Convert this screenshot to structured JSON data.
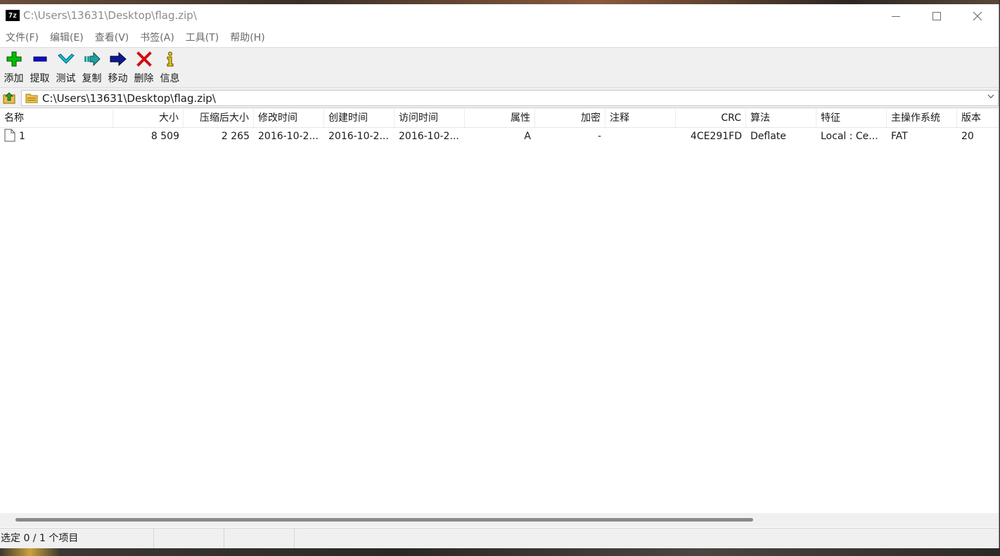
{
  "window": {
    "title": "C:\\Users\\13631\\Desktop\\flag.zip\\",
    "app_icon_text": "7z"
  },
  "menu": [
    {
      "label": "文件(F)"
    },
    {
      "label": "编辑(E)"
    },
    {
      "label": "查看(V)"
    },
    {
      "label": "书签(A)"
    },
    {
      "label": "工具(T)"
    },
    {
      "label": "帮助(H)"
    }
  ],
  "toolbar": [
    {
      "label": "添加",
      "icon": "plus-icon",
      "color": "#00c000"
    },
    {
      "label": "提取",
      "icon": "minus-icon",
      "color": "#1010c0"
    },
    {
      "label": "测试",
      "icon": "check-icon",
      "color": "#00b8c8"
    },
    {
      "label": "复制",
      "icon": "copy-arrow-icon",
      "color": "#20a0a0"
    },
    {
      "label": "移动",
      "icon": "move-arrow-icon",
      "color": "#101890"
    },
    {
      "label": "删除",
      "icon": "delete-x-icon",
      "color": "#d01010"
    },
    {
      "label": "信息",
      "icon": "info-icon",
      "color": "#e8c800"
    }
  ],
  "address": {
    "path": "C:\\Users\\13631\\Desktop\\flag.zip\\"
  },
  "columns": [
    {
      "key": "name",
      "label": "名称"
    },
    {
      "key": "size",
      "label": "大小"
    },
    {
      "key": "packed",
      "label": "压缩后大小"
    },
    {
      "key": "modified",
      "label": "修改时间"
    },
    {
      "key": "created",
      "label": "创建时间"
    },
    {
      "key": "accessed",
      "label": "访问时间"
    },
    {
      "key": "attributes",
      "label": "属性"
    },
    {
      "key": "encrypted",
      "label": "加密"
    },
    {
      "key": "comment",
      "label": "注释"
    },
    {
      "key": "crc",
      "label": "CRC"
    },
    {
      "key": "method",
      "label": "算法"
    },
    {
      "key": "characteristics",
      "label": "特征"
    },
    {
      "key": "host_os",
      "label": "主操作系统"
    },
    {
      "key": "version",
      "label": "版本"
    }
  ],
  "rows": [
    {
      "name": "1",
      "size": "8 509",
      "packed": "2 265",
      "modified": "2016-10-2...",
      "created": "2016-10-2...",
      "accessed": "2016-10-2...",
      "attributes": "A",
      "encrypted": "-",
      "comment": "",
      "crc": "4CE291FD",
      "method": "Deflate",
      "characteristics": "Local : Ce...",
      "host_os": "FAT",
      "version": "20"
    }
  ],
  "status": {
    "selection": "选定 0 / 1 个项目",
    "cell2": "",
    "cell3": ""
  }
}
